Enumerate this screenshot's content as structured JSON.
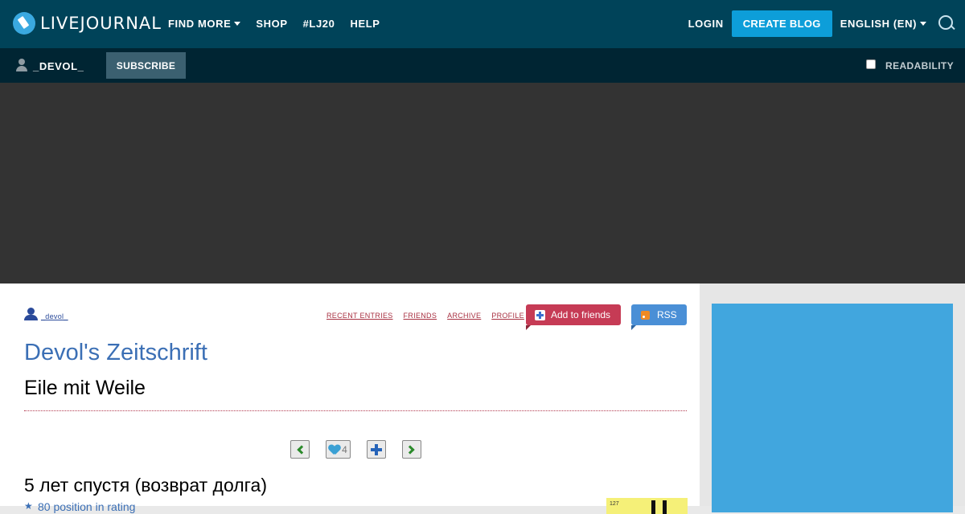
{
  "header": {
    "logo_text": "LIVEJOURNAL",
    "nav": {
      "find_more": "FIND MORE",
      "shop": "SHOP",
      "lj20": "#LJ20",
      "help": "HELP"
    },
    "login": "LOGIN",
    "create_blog": "CREATE BLOG",
    "language": "ENGLISH (EN)"
  },
  "subheader": {
    "username": "_DEVOL_",
    "subscribe": "SUBSCRIBE",
    "readability": "READABILITY"
  },
  "blog": {
    "username": "_devol_",
    "links": {
      "recent_entries": "RECENT ENTRIES",
      "friends": "FRIENDS",
      "archive": "ARCHIVE",
      "profile": "PROFILE"
    },
    "add_to_friends": "Add to friends",
    "rss": "RSS",
    "title": "Devol's Zeitschrift",
    "subtitle": "Eile mit Weile"
  },
  "post": {
    "likes": "4",
    "title": "5 лет спустя (возврат долга)",
    "rating": "80 position in rating",
    "badge_number": "127"
  },
  "colors": {
    "topbar": "#004359",
    "subbar": "#002533",
    "accent": "#0d9ed9",
    "title_blue": "#3b6fb5",
    "link_red": "#a83041",
    "add_friends": "#c63b55",
    "rss": "#4a8fd6",
    "side_block": "#41a6de"
  },
  "icons": {
    "logo": "livejournal-pen-icon",
    "search": "search-icon",
    "user": "user-icon",
    "add_friend": "plus-icon",
    "rss": "rss-icon",
    "prev": "chevron-left-icon",
    "like": "heart-icon",
    "add": "plus-icon",
    "next": "chevron-right-icon",
    "rating": "star-icon"
  }
}
